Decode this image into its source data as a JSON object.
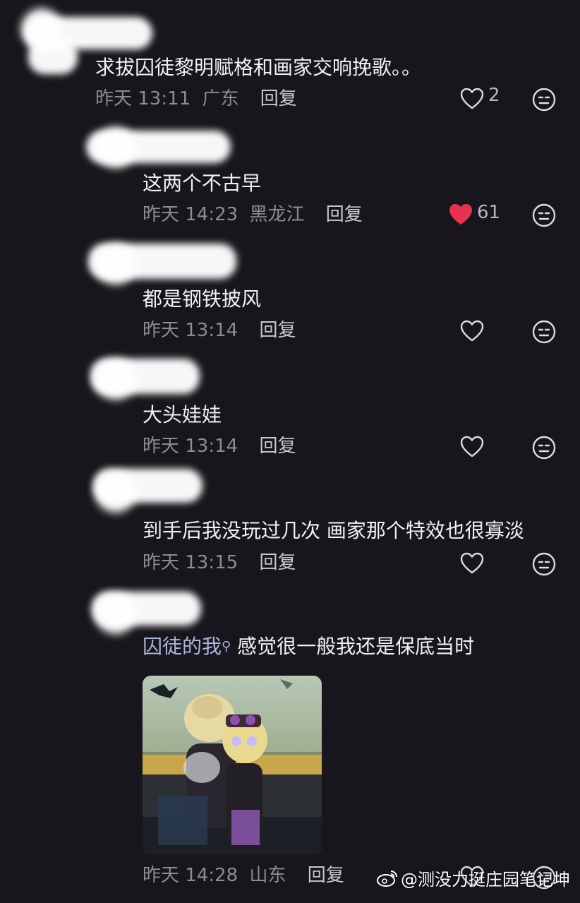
{
  "comments": [
    {
      "text": "求拔囚徒黎明赋格和画家交响挽歌。。",
      "time": "昨天 13:11",
      "location": "广东",
      "reply": "回复",
      "likes": "2",
      "liked": false
    },
    {
      "text": "这两个不古早",
      "time": "昨天 14:23",
      "location": "黑龙江",
      "reply": "回复",
      "likes": "61",
      "liked": true
    },
    {
      "text": "都是钢铁披风",
      "time": "昨天 13:14",
      "location": "",
      "reply": "回复",
      "likes": "",
      "liked": false
    },
    {
      "text": "大头娃娃",
      "time": "昨天 13:14",
      "location": "",
      "reply": "回复",
      "likes": "",
      "liked": false
    },
    {
      "text": "到手后我没玩过几次 画家那个特效也很寡淡",
      "time": "昨天 13:15",
      "location": "",
      "reply": "回复",
      "likes": "",
      "liked": false
    },
    {
      "mention": "囚徒的我",
      "text": "感觉很一般我还是保底当时",
      "time": "昨天 14:28",
      "location": "山东",
      "reply": "回复",
      "likes": "",
      "liked": false
    }
  ],
  "watermark": "@测没力挺庄园笔记坤",
  "colors": {
    "background": "#17161c",
    "liked_heart": "#e8314f",
    "meta_text": "#8d8c93"
  }
}
